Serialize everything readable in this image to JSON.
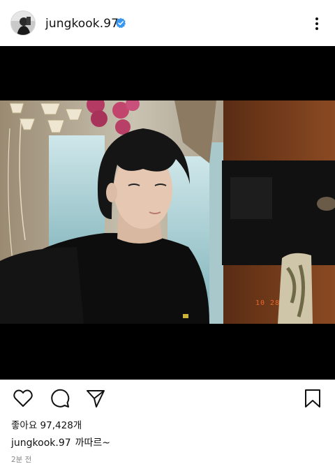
{
  "header": {
    "username": "jungkook.97",
    "verified_icon": "verified-badge-icon",
    "more_icon": "more-vertical-icon"
  },
  "post": {
    "image_icon": "selfie-photo",
    "photo_timestamp": "10 28",
    "likes_text": "좋아요 97,428개",
    "caption_user": "jungkook.97",
    "caption_text": "까따르~",
    "time_ago": "2분 전"
  },
  "actions": {
    "like_icon": "heart-icon",
    "comment_icon": "comment-icon",
    "share_icon": "send-icon",
    "save_icon": "bookmark-icon"
  },
  "colors": {
    "verified_blue": "#3897f0",
    "text": "#111111",
    "secondary_text": "#8a8a8a"
  }
}
